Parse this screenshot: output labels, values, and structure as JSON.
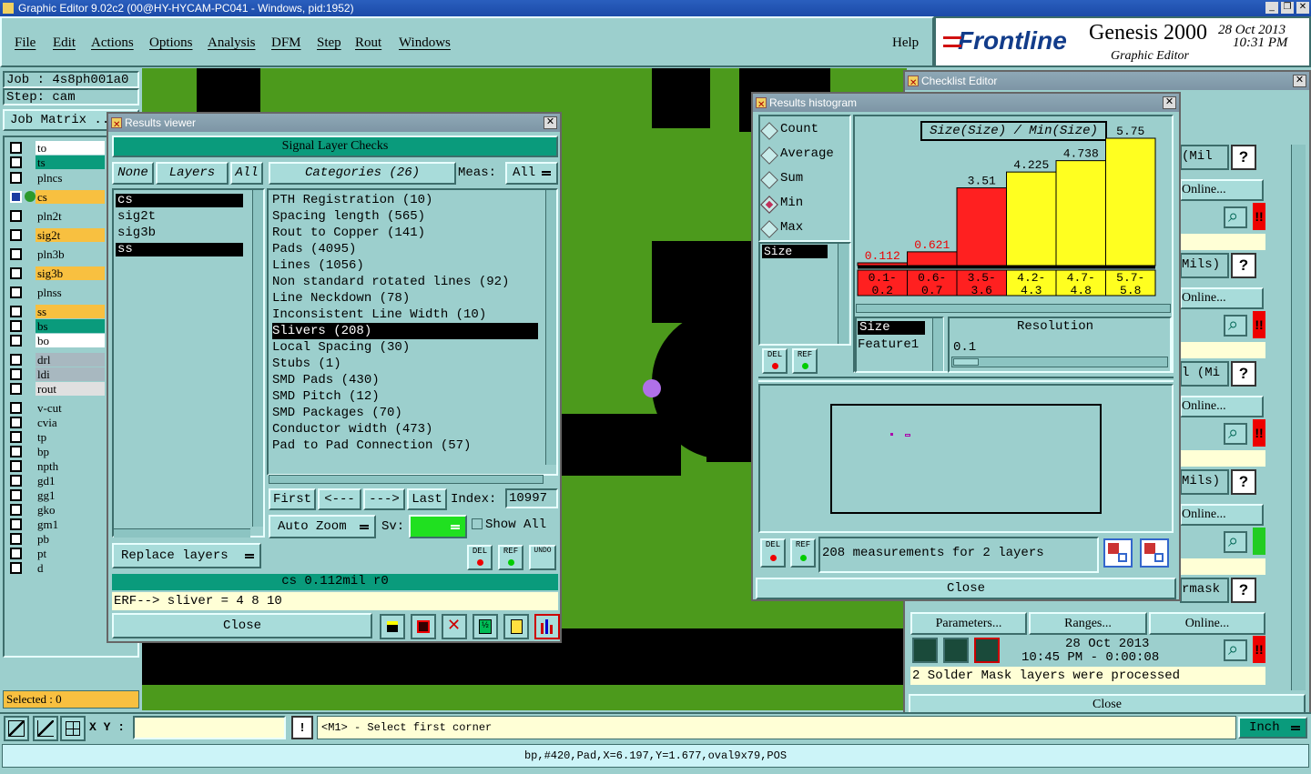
{
  "title": "Graphic Editor 9.02c2 (00@HY-HYCAM-PC041 - Windows, pid:1952)",
  "menu": [
    "File",
    "Edit",
    "Actions",
    "Options",
    "Analysis",
    "DFM",
    "Step",
    "Rout",
    "Windows"
  ],
  "help": "Help",
  "brand": {
    "logo": "Frontline",
    "product": "Genesis 2000",
    "sub": "Graphic Editor",
    "date": "28 Oct 2013",
    "time": "10:31 PM"
  },
  "job": {
    "job": "Job : 4s8ph001a0",
    "step": "Step: cam",
    "matrix": "Job Matrix .."
  },
  "layers": [
    {
      "name": "to",
      "color": "#ffffff"
    },
    {
      "name": "ts",
      "color": "#0a9b7c"
    },
    {
      "name": "plncs",
      "color": "#9ccfcd"
    },
    {
      "name": "cs",
      "color": "#f8c040"
    },
    {
      "name": "pln2t",
      "color": "#9ccfcd"
    },
    {
      "name": "sig2t",
      "color": "#f8c040"
    },
    {
      "name": "pln3b",
      "color": "#9ccfcd"
    },
    {
      "name": "sig3b",
      "color": "#f8c040"
    },
    {
      "name": "plnss",
      "color": "#9ccfcd"
    },
    {
      "name": "ss",
      "color": "#f8c040"
    },
    {
      "name": "bs",
      "color": "#0a9b7c"
    },
    {
      "name": "bo",
      "color": "#ffffff"
    },
    {
      "name": "drl",
      "color": "#a8b8c0"
    },
    {
      "name": "ldi",
      "color": "#a8b8c0"
    },
    {
      "name": "rout",
      "color": "#e0e0e0"
    },
    {
      "name": "v-cut",
      "color": "#9ccfcd"
    },
    {
      "name": "cvia",
      "color": "#9ccfcd"
    },
    {
      "name": "tp",
      "color": "#9ccfcd"
    },
    {
      "name": "bp",
      "color": "#9ccfcd"
    },
    {
      "name": "npth",
      "color": "#9ccfcd"
    },
    {
      "name": "gd1",
      "color": "#9ccfcd"
    },
    {
      "name": "gg1",
      "color": "#9ccfcd"
    },
    {
      "name": "gko",
      "color": "#9ccfcd"
    },
    {
      "name": "gm1",
      "color": "#9ccfcd"
    },
    {
      "name": "pb",
      "color": "#9ccfcd"
    },
    {
      "name": "pt",
      "color": "#9ccfcd"
    },
    {
      "name": "d",
      "color": "#9ccfcd"
    }
  ],
  "selected": "Selected : 0",
  "results_viewer": {
    "title": "Results viewer",
    "header": "Signal Layer Checks",
    "none": "None",
    "layers_btn": "Layers",
    "all": "All",
    "categories_btn": "Categories (26)",
    "meas_label": "Meas:",
    "meas_value": "All",
    "layer_list": [
      "cs",
      "sig2t",
      "sig3b",
      "ss"
    ],
    "categories": [
      "PTH Registration (10)",
      "Spacing length (565)",
      "Rout to Copper (141)",
      "Pads (4095)",
      "Lines (1056)",
      "Non standard rotated lines (92)",
      "Line Neckdown (78)",
      "Inconsistent Line Width (10)",
      "Slivers (208)",
      "Local Spacing (30)",
      "Stubs (1)",
      "SMD Pads (430)",
      "SMD Pitch (12)",
      "SMD Packages (70)",
      "Conductor width (473)",
      "Pad to Pad Connection (57)"
    ],
    "selected_category": "Slivers (208)",
    "first": "First",
    "prev": "<---",
    "next": "--->",
    "last": "Last",
    "index_label": "Index:",
    "index_value": "10997",
    "autozoom": "Auto Zoom",
    "sv": "Sv:",
    "showall": "Show All",
    "replace": "Replace layers",
    "del": "DEL",
    "ref": "REF",
    "undo": "UNDO",
    "status": "cs 0.112mil  r0",
    "erf": "ERF--> sliver = 4 8 10",
    "close": "Close"
  },
  "histogram": {
    "title": "Results histogram",
    "options": [
      "Count",
      "Average",
      "Sum",
      "Min",
      "Max"
    ],
    "selected_option": "Min",
    "formula": "Size(Size) / Min(Size)",
    "list_item": "Size",
    "del": "DEL",
    "ref": "REF",
    "attr": [
      "Size",
      "Feature1"
    ],
    "resolution_label": "Resolution",
    "resolution_value": "0.1",
    "measurements": "208 measurements for 2 layers",
    "close": "Close"
  },
  "chart_data": {
    "type": "bar",
    "categories": [
      "0.1-0.2",
      "0.6-0.7",
      "3.5-3.6",
      "4.2-4.3",
      "4.7-4.8",
      "5.7-5.8"
    ],
    "cat_lines": [
      [
        "0.1-",
        "0.2"
      ],
      [
        "0.6-",
        "0.7"
      ],
      [
        "3.5-",
        "3.6"
      ],
      [
        "4.2-",
        "4.3"
      ],
      [
        "4.7-",
        "4.8"
      ],
      [
        "5.7-",
        "5.8"
      ]
    ],
    "values": [
      0.112,
      0.621,
      3.51,
      4.225,
      4.738,
      5.75
    ],
    "value_labels": [
      "0.112",
      "0.621",
      "3.51",
      "4.225",
      "4.738",
      "5.75"
    ],
    "colors": [
      "#ff2020",
      "#ff2020",
      "#ff2020",
      "#ffff20",
      "#ffff20",
      "#ffff20"
    ],
    "ylim": [
      0,
      5.75
    ]
  },
  "checklist": {
    "title": "Checklist Editor",
    "items": [
      {
        "label": "(Mil",
        "online": "Online..."
      },
      {
        "label": "Mils)",
        "online": "Online..."
      },
      {
        "label": "l (Mi",
        "online": "Online..."
      },
      {
        "label": "Mils)",
        "online": "Online..."
      },
      {
        "label": "rmask",
        "online": ""
      }
    ],
    "parameters": "Parameters...",
    "ranges": "Ranges...",
    "online": "Online...",
    "date": "28 Oct 2013",
    "time": "10:45 PM - 0:00:08",
    "processed": "2 Solder Mask layers were processed",
    "close": "Close"
  },
  "bottom": {
    "xy": "X Y :",
    "bang": "!",
    "prompt": "<M1> - Select first corner",
    "units": "Inch",
    "status": "bp,#420,Pad,X=6.197,Y=1.677,oval9x79,POS"
  }
}
